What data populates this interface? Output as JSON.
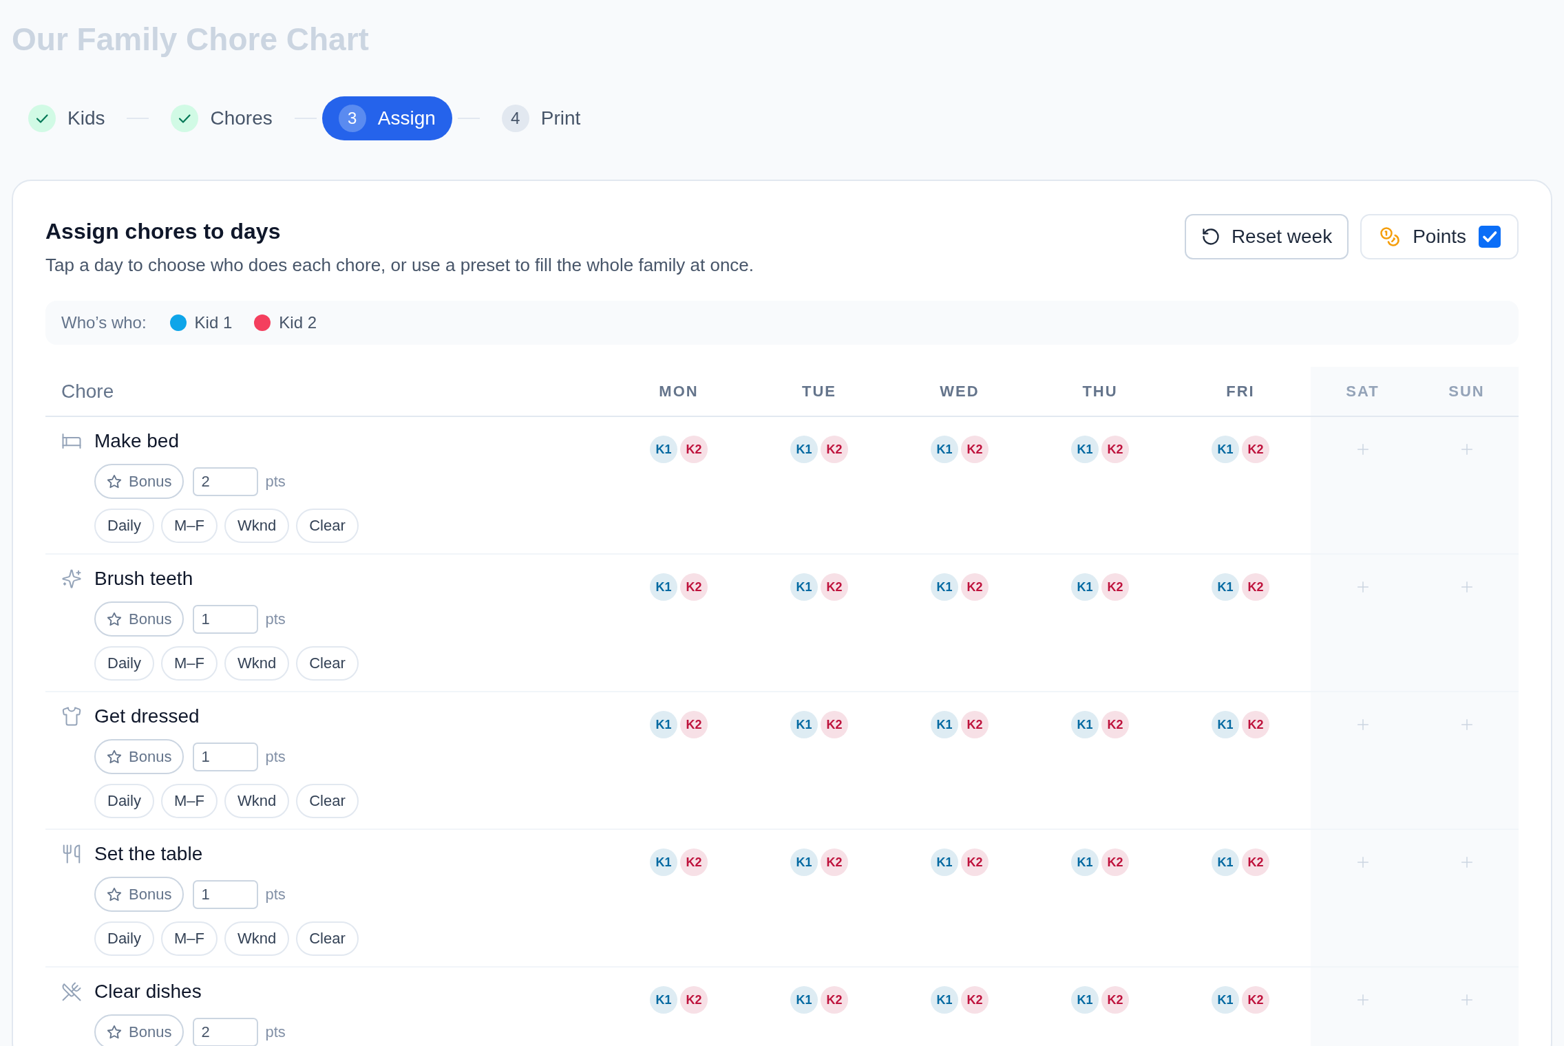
{
  "page_title": "Our Family Chore Chart",
  "stepper": {
    "steps": [
      {
        "label": "Kids",
        "done": true,
        "selected": false
      },
      {
        "label": "Chores",
        "done": true,
        "selected": false
      },
      {
        "number": "3",
        "label": "Assign",
        "done": false,
        "selected": true
      },
      {
        "number": "4",
        "label": "Print",
        "done": false,
        "selected": false
      }
    ]
  },
  "assign_panel": {
    "title": "Assign chores to days",
    "description": "Tap a day to choose who does each chore, or use a preset to fill the whole family at once.",
    "reset_button": "Reset week",
    "points_toggle": {
      "label": "Points",
      "checked": true
    },
    "legend": {
      "label": "Who’s who:",
      "kids": [
        {
          "name": "Kid 1",
          "color": "#0ea5e9"
        },
        {
          "name": "Kid 2",
          "color": "#f43f5e"
        }
      ]
    },
    "table": {
      "chore_column": "Chore",
      "days": [
        {
          "label": "MON",
          "weekend": false
        },
        {
          "label": "TUE",
          "weekend": false
        },
        {
          "label": "WED",
          "weekend": false
        },
        {
          "label": "THU",
          "weekend": false
        },
        {
          "label": "FRI",
          "weekend": false
        },
        {
          "label": "SAT",
          "weekend": true
        },
        {
          "label": "SUN",
          "weekend": true
        }
      ],
      "rows": [
        {
          "chore": "Make bed",
          "bonus_label": "Bonus",
          "points": "2",
          "points_unit": "pts",
          "presets": [
            "Daily",
            "M–F",
            "Wknd",
            "Clear"
          ],
          "days": [
            {
              "assigned": true,
              "assignees": [
                {
                  "label": "K1",
                  "color": "#0369a1"
                },
                {
                  "label": "K2",
                  "color": "#be123c"
                }
              ]
            },
            {
              "assigned": true,
              "assignees": [
                {
                  "label": "K1",
                  "color": "#0369a1"
                },
                {
                  "label": "K2",
                  "color": "#be123c"
                }
              ]
            },
            {
              "assigned": true,
              "assignees": [
                {
                  "label": "K1",
                  "color": "#0369a1"
                },
                {
                  "label": "K2",
                  "color": "#be123c"
                }
              ]
            },
            {
              "assigned": true,
              "assignees": [
                {
                  "label": "K1",
                  "color": "#0369a1"
                },
                {
                  "label": "K2",
                  "color": "#be123c"
                }
              ]
            },
            {
              "assigned": true,
              "assignees": [
                {
                  "label": "K1",
                  "color": "#0369a1"
                },
                {
                  "label": "K2",
                  "color": "#be123c"
                }
              ]
            },
            {
              "assigned": false
            },
            {
              "assigned": false
            }
          ]
        },
        {
          "chore": "Brush teeth",
          "bonus_label": "Bonus",
          "points": "1",
          "points_unit": "pts",
          "presets": [
            "Daily",
            "M–F",
            "Wknd",
            "Clear"
          ],
          "days": [
            {
              "assigned": true,
              "assignees": [
                {
                  "label": "K1",
                  "color": "#0369a1"
                },
                {
                  "label": "K2",
                  "color": "#be123c"
                }
              ]
            },
            {
              "assigned": true,
              "assignees": [
                {
                  "label": "K1",
                  "color": "#0369a1"
                },
                {
                  "label": "K2",
                  "color": "#be123c"
                }
              ]
            },
            {
              "assigned": true,
              "assignees": [
                {
                  "label": "K1",
                  "color": "#0369a1"
                },
                {
                  "label": "K2",
                  "color": "#be123c"
                }
              ]
            },
            {
              "assigned": true,
              "assignees": [
                {
                  "label": "K1",
                  "color": "#0369a1"
                },
                {
                  "label": "K2",
                  "color": "#be123c"
                }
              ]
            },
            {
              "assigned": true,
              "assignees": [
                {
                  "label": "K1",
                  "color": "#0369a1"
                },
                {
                  "label": "K2",
                  "color": "#be123c"
                }
              ]
            },
            {
              "assigned": false
            },
            {
              "assigned": false
            }
          ]
        },
        {
          "chore": "Get dressed",
          "bonus_label": "Bonus",
          "points": "1",
          "points_unit": "pts",
          "presets": [
            "Daily",
            "M–F",
            "Wknd",
            "Clear"
          ],
          "days": [
            {
              "assigned": true,
              "assignees": [
                {
                  "label": "K1",
                  "color": "#0369a1"
                },
                {
                  "label": "K2",
                  "color": "#be123c"
                }
              ]
            },
            {
              "assigned": true,
              "assignees": [
                {
                  "label": "K1",
                  "color": "#0369a1"
                },
                {
                  "label": "K2",
                  "color": "#be123c"
                }
              ]
            },
            {
              "assigned": true,
              "assignees": [
                {
                  "label": "K1",
                  "color": "#0369a1"
                },
                {
                  "label": "K2",
                  "color": "#be123c"
                }
              ]
            },
            {
              "assigned": true,
              "assignees": [
                {
                  "label": "K1",
                  "color": "#0369a1"
                },
                {
                  "label": "K2",
                  "color": "#be123c"
                }
              ]
            },
            {
              "assigned": true,
              "assignees": [
                {
                  "label": "K1",
                  "color": "#0369a1"
                },
                {
                  "label": "K2",
                  "color": "#be123c"
                }
              ]
            },
            {
              "assigned": false
            },
            {
              "assigned": false
            }
          ]
        },
        {
          "chore": "Set the table",
          "bonus_label": "Bonus",
          "points": "1",
          "points_unit": "pts",
          "presets": [
            "Daily",
            "M–F",
            "Wknd",
            "Clear"
          ],
          "days": [
            {
              "assigned": true,
              "assignees": [
                {
                  "label": "K1",
                  "color": "#0369a1"
                },
                {
                  "label": "K2",
                  "color": "#be123c"
                }
              ]
            },
            {
              "assigned": true,
              "assignees": [
                {
                  "label": "K1",
                  "color": "#0369a1"
                },
                {
                  "label": "K2",
                  "color": "#be123c"
                }
              ]
            },
            {
              "assigned": true,
              "assignees": [
                {
                  "label": "K1",
                  "color": "#0369a1"
                },
                {
                  "label": "K2",
                  "color": "#be123c"
                }
              ]
            },
            {
              "assigned": true,
              "assignees": [
                {
                  "label": "K1",
                  "color": "#0369a1"
                },
                {
                  "label": "K2",
                  "color": "#be123c"
                }
              ]
            },
            {
              "assigned": true,
              "assignees": [
                {
                  "label": "K1",
                  "color": "#0369a1"
                },
                {
                  "label": "K2",
                  "color": "#be123c"
                }
              ]
            },
            {
              "assigned": false
            },
            {
              "assigned": false
            }
          ]
        },
        {
          "chore": "Clear dishes",
          "bonus_label": "Bonus",
          "points": "2",
          "points_unit": "pts",
          "days": [
            {
              "assigned": true,
              "assignees": [
                {
                  "label": "K1",
                  "color": "#0369a1"
                },
                {
                  "label": "K2",
                  "color": "#be123c"
                }
              ]
            },
            {
              "assigned": true,
              "assignees": [
                {
                  "label": "K1",
                  "color": "#0369a1"
                },
                {
                  "label": "K2",
                  "color": "#be123c"
                }
              ]
            },
            {
              "assigned": true,
              "assignees": [
                {
                  "label": "K1",
                  "color": "#0369a1"
                },
                {
                  "label": "K2",
                  "color": "#be123c"
                }
              ]
            },
            {
              "assigned": true,
              "assignees": [
                {
                  "label": "K1",
                  "color": "#0369a1"
                },
                {
                  "label": "K2",
                  "color": "#be123c"
                }
              ]
            },
            {
              "assigned": true,
              "assignees": [
                {
                  "label": "K1",
                  "color": "#0369a1"
                },
                {
                  "label": "K2",
                  "color": "#be123c"
                }
              ]
            },
            {
              "assigned": false
            },
            {
              "assigned": false
            }
          ]
        }
      ]
    }
  }
}
